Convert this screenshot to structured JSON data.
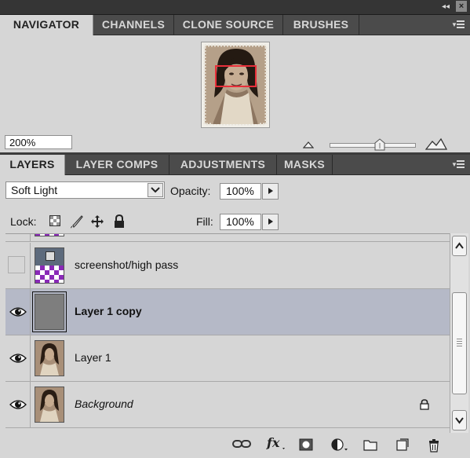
{
  "navigator_panel": {
    "tabs": [
      {
        "label": "NAVIGATOR",
        "active": true
      },
      {
        "label": "CHANNELS",
        "active": false
      },
      {
        "label": "CLONE SOURCE",
        "active": false
      },
      {
        "label": "BRUSHES",
        "active": false
      }
    ],
    "zoom_value": "200%",
    "zoom_slider_fraction": 0.6,
    "view_box_color": "#e8303a"
  },
  "layers_panel": {
    "tabs": [
      {
        "label": "LAYERS",
        "active": true
      },
      {
        "label": "LAYER COMPS",
        "active": false
      },
      {
        "label": "ADJUSTMENTS",
        "active": false
      },
      {
        "label": "MASKS",
        "active": false
      }
    ],
    "blend_mode": "Soft Light",
    "opacity_label": "Opacity:",
    "opacity_value": "100%",
    "lock_label": "Lock:",
    "fill_label": "Fill:",
    "fill_value": "100%",
    "lock_icons": [
      "lock-transparent-pixels-icon",
      "lock-image-pixels-icon",
      "lock-position-icon",
      "lock-all-icon"
    ],
    "layers": [
      {
        "name": "screenshot/high pass",
        "visible": false,
        "selected": false,
        "style": "normal",
        "locked": false,
        "thumb": "screenshot"
      },
      {
        "name": "Layer 1 copy",
        "visible": true,
        "selected": true,
        "style": "bold",
        "locked": false,
        "thumb": "gray"
      },
      {
        "name": "Layer 1",
        "visible": true,
        "selected": false,
        "style": "normal",
        "locked": false,
        "thumb": "photo"
      },
      {
        "name": "Background",
        "visible": true,
        "selected": false,
        "style": "italic",
        "locked": true,
        "thumb": "photo"
      }
    ],
    "selection_color": "#b5b9c7",
    "footer_icons": [
      "link-layers-icon",
      "layer-style-fx-icon",
      "add-mask-icon",
      "adjustment-layer-icon",
      "new-group-icon",
      "new-layer-icon",
      "delete-layer-icon"
    ]
  }
}
